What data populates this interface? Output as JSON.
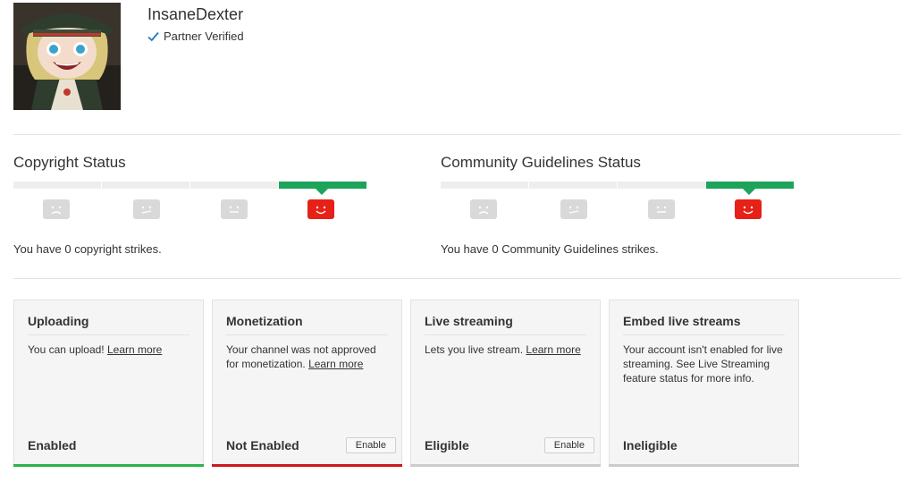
{
  "channel": {
    "name": "InsaneDexter",
    "verified_label": "Partner Verified"
  },
  "copyright": {
    "title": "Copyright Status",
    "strikes_text": "You have 0 copyright strikes.",
    "active_level": 4
  },
  "community": {
    "title": "Community Guidelines Status",
    "strikes_text": "You have 0 Community Guidelines strikes.",
    "active_level": 4
  },
  "colors": {
    "active_segment": "#1ea35b",
    "inactive_segment": "#eeeeee",
    "happy_face": "#e62117",
    "neutral_face": "#d9d9d9"
  },
  "features": [
    {
      "title": "Uploading",
      "description": "You can upload!",
      "link": "Learn more",
      "state": "Enabled",
      "bar_color": "green"
    },
    {
      "title": "Monetization",
      "description": "Your channel was not approved for monetization.",
      "link": "Learn more",
      "state": "Not Enabled",
      "button": "Enable",
      "bar_color": "red"
    },
    {
      "title": "Live streaming",
      "description": "Lets you live stream.",
      "link": "Learn more",
      "state": "Eligible",
      "button": "Enable",
      "bar_color": "gray"
    },
    {
      "title": "Embed live streams",
      "description": "Your account isn't enabled for live streaming. See Live Streaming feature status for more info.",
      "state": "Ineligible",
      "bar_color": "gray"
    }
  ]
}
